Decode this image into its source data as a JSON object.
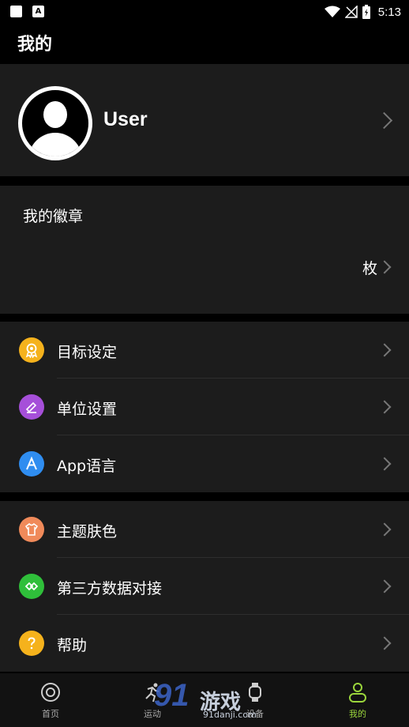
{
  "status_bar": {
    "time": "5:13"
  },
  "header": {
    "title": "我的"
  },
  "profile": {
    "username": "User"
  },
  "badges": {
    "label": "我的徽章",
    "count_unit": "枚"
  },
  "menu_group_1": [
    {
      "label": "目标设定",
      "icon": "medal-icon",
      "color": "#F5B21C"
    },
    {
      "label": "单位设置",
      "icon": "ruler-icon",
      "color": "#A64FD9"
    },
    {
      "label": "App语言",
      "icon": "letter-a-icon",
      "color": "#2F8DF0"
    }
  ],
  "menu_group_2": [
    {
      "label": "主题肤色",
      "icon": "tshirt-icon",
      "color": "#F08A5A"
    },
    {
      "label": "第三方数据对接",
      "icon": "link-icon",
      "color": "#2FBF3A"
    },
    {
      "label": "帮助",
      "icon": "question-icon",
      "color": "#F5B21C"
    }
  ],
  "bottom_nav": [
    {
      "label": "首页",
      "icon": "home-target-icon"
    },
    {
      "label": "运动",
      "icon": "running-icon"
    },
    {
      "label": "设备",
      "icon": "watch-icon"
    },
    {
      "label": "我的",
      "icon": "person-icon",
      "active": true
    }
  ],
  "watermark": {
    "logo_digits": "91",
    "brand": "游戏",
    "url": "91danji.com"
  },
  "colors": {
    "accent": "#9BD63C",
    "card_bg": "#1C1C1C"
  }
}
